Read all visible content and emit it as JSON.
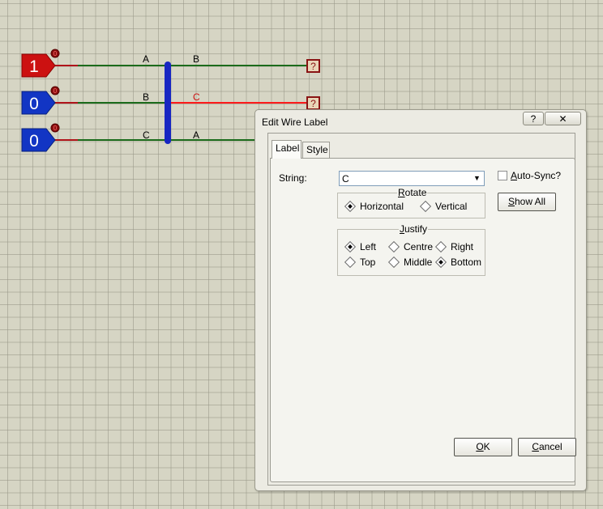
{
  "schematic": {
    "terminals": [
      {
        "value": "1",
        "pin": "0",
        "color": "#cc1111"
      },
      {
        "value": "0",
        "pin": "0",
        "color": "#1235c4"
      },
      {
        "value": "0",
        "pin": "0",
        "color": "#1235c4"
      }
    ],
    "left_labels": [
      "A",
      "B",
      "C"
    ],
    "right_labels": [
      "B",
      "C",
      "A"
    ],
    "probe_symbol": "?",
    "bus_color": "#1726c2",
    "wire_color": "#1b6b1b",
    "selected_wire_color": "#ff1a1a"
  },
  "dialog": {
    "title": "Edit Wire Label",
    "help_glyph": "?",
    "close_glyph": "✕",
    "tabs": [
      "Label",
      "Style"
    ],
    "string_label": "String:",
    "string_value": "C",
    "auto_sync_label": "Auto-Sync?",
    "auto_sync_checked": false,
    "show_all_label": "Show All",
    "rotate": {
      "title": "Rotate",
      "options": [
        {
          "label": "Horizontal",
          "selected": true
        },
        {
          "label": "Vertical",
          "selected": false
        }
      ]
    },
    "justify": {
      "title": "Justify",
      "options": [
        {
          "label": "Left",
          "selected": true
        },
        {
          "label": "Centre",
          "selected": false
        },
        {
          "label": "Right",
          "selected": false
        },
        {
          "label": "Top",
          "selected": false
        },
        {
          "label": "Middle",
          "selected": false
        },
        {
          "label": "Bottom",
          "selected": true
        }
      ]
    },
    "ok_label": "OK",
    "cancel_label": "Cancel"
  }
}
